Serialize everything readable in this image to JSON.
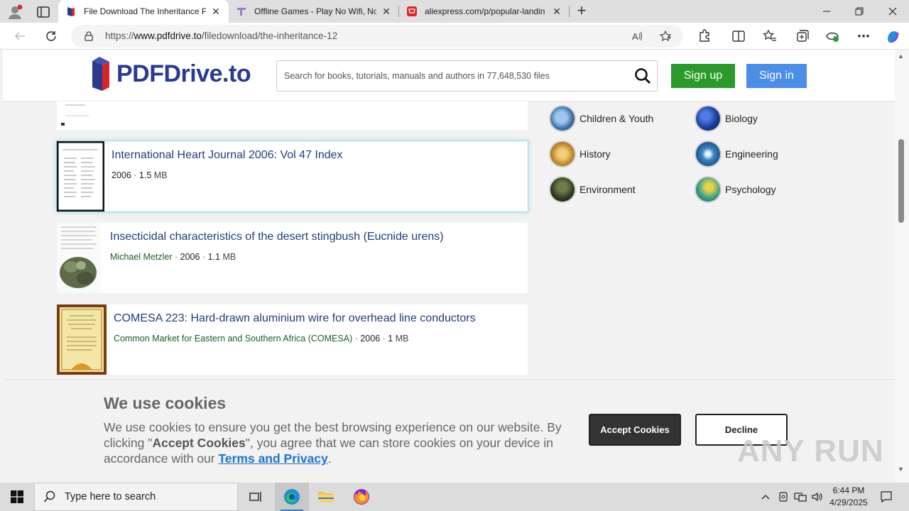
{
  "browser": {
    "tabs": [
      {
        "title": "File Download The Inheritance PD",
        "active": true
      },
      {
        "title": "Offline Games - Play No Wifi, No",
        "active": false
      },
      {
        "title": "aliexpress.com/p/popular-landin",
        "active": false
      }
    ],
    "url": {
      "prefix": "https://",
      "host": "www.pdfdrive.to",
      "path": "/filedownload/the-inheritance-12"
    }
  },
  "site": {
    "logo_text": "PDFDrive.to",
    "search_placeholder": "Search for books, tutorials, manuals and authors in 77,648,530 files",
    "signup_label": "Sign up",
    "signin_label": "Sign in"
  },
  "results": [
    {
      "title": "International Heart Journal 2006: Vol 47 Index",
      "author": "",
      "year": "2006",
      "size_num": "1.5",
      "size_unit": "MB"
    },
    {
      "title": "Insecticidal characteristics of the desert stingbush (Eucnide urens)",
      "author": "Michael Metzler",
      "year": "2006",
      "size_num": "1.1",
      "size_unit": "MB"
    },
    {
      "title": "COMESA 223: Hard-drawn aluminium wire for overhead line conductors",
      "author": "Common Market for Eastern and Southern Africa (COMESA)",
      "year": "2006",
      "size_num": "1",
      "size_unit": "MB"
    }
  ],
  "categories": [
    {
      "label": "Children & Youth",
      "color": "#5a86b8"
    },
    {
      "label": "Biology",
      "color": "#1b3f9a"
    },
    {
      "label": "History",
      "color": "#c9952e"
    },
    {
      "label": "Engineering",
      "color": "#1c5a8a"
    },
    {
      "label": "Environment",
      "color": "#2e3b20"
    },
    {
      "label": "Psychology",
      "color": "#3aa38a"
    }
  ],
  "cookies": {
    "heading": "We use cookies",
    "text_1": "We use cookies to ensure you get the best browsing experience on our website. By clicking \"",
    "text_bold": "Accept Cookies",
    "text_2": "\", you agree that we can store cookies on your device in accordance with our ",
    "link": "Terms and Privacy",
    "text_3": ".",
    "accept_label": "Accept Cookies",
    "decline_label": "Decline",
    "watermark": "ANY RUN"
  },
  "taskbar": {
    "search_placeholder": "Type here to search",
    "time": "6:44 PM",
    "date": "4/29/2025"
  }
}
